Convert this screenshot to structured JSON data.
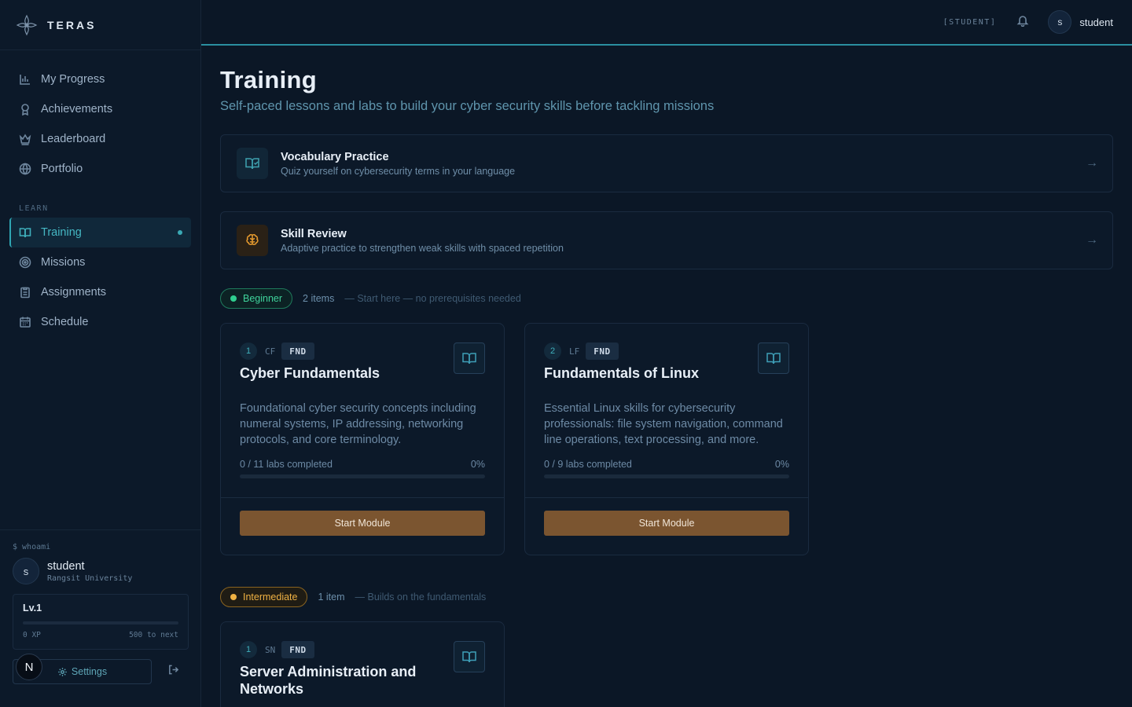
{
  "brand": {
    "name": "TERAS"
  },
  "nav": {
    "items": [
      {
        "label": "My Progress",
        "icon": "bar-chart-icon"
      },
      {
        "label": "Achievements",
        "icon": "award-icon"
      },
      {
        "label": "Leaderboard",
        "icon": "crown-icon"
      },
      {
        "label": "Portfolio",
        "icon": "globe-icon"
      }
    ],
    "section_learn": "LEARN",
    "learn_items": [
      {
        "label": "Training",
        "icon": "book-open-icon",
        "active": true
      },
      {
        "label": "Missions",
        "icon": "target-icon"
      },
      {
        "label": "Assignments",
        "icon": "clipboard-icon"
      },
      {
        "label": "Schedule",
        "icon": "calendar-icon"
      }
    ]
  },
  "user_panel": {
    "prompt": "$ whoami",
    "avatar_letter": "s",
    "name": "student",
    "org": "Rangsit University",
    "level": "Lv.1",
    "xp": "0 XP",
    "xp_next": "500 to next",
    "xp_progress": 0,
    "badge_letter": "N",
    "settings_label": "Settings"
  },
  "topbar": {
    "role": "[STUDENT]",
    "avatar_letter": "s",
    "username": "student"
  },
  "page": {
    "title": "Training",
    "subtitle": "Self-paced lessons and labs to build your cyber security skills before tackling missions"
  },
  "features": [
    {
      "title": "Vocabulary Practice",
      "desc": "Quiz yourself on cybersecurity terms in your language",
      "arrow": "→"
    },
    {
      "title": "Skill Review",
      "desc": "Adaptive practice to strengthen weak skills with spaced repetition",
      "arrow": "→"
    }
  ],
  "levels": {
    "beginner": {
      "label": "Beginner",
      "count": "2 items",
      "note": "— Start here — no prerequisites needed",
      "modules": [
        {
          "num": "1",
          "code": "CF",
          "tag": "FND",
          "title": "Cyber Fundamentals",
          "desc": "Foundational cyber security concepts including numeral systems, IP addressing, networking protocols, and core terminology.",
          "progress_text": "0 / 11 labs completed",
          "percent": "0%",
          "progress": 0,
          "button": "Start Module"
        },
        {
          "num": "2",
          "code": "LF",
          "tag": "FND",
          "title": "Fundamentals of Linux",
          "desc": "Essential Linux skills for cybersecurity professionals: file system navigation, command line operations, text processing, and more.",
          "progress_text": "0 / 9 labs completed",
          "percent": "0%",
          "progress": 0,
          "button": "Start Module"
        }
      ]
    },
    "intermediate": {
      "label": "Intermediate",
      "count": "1 item",
      "note": "— Builds on the fundamentals",
      "modules": [
        {
          "num": "1",
          "code": "SN",
          "tag": "FND",
          "title": "Server Administration and Networks"
        }
      ]
    }
  },
  "colors": {
    "accent": "#2fa6b3",
    "start_button": "#7b5530",
    "beginner": "#2fcf8f",
    "intermediate": "#f0b243"
  }
}
